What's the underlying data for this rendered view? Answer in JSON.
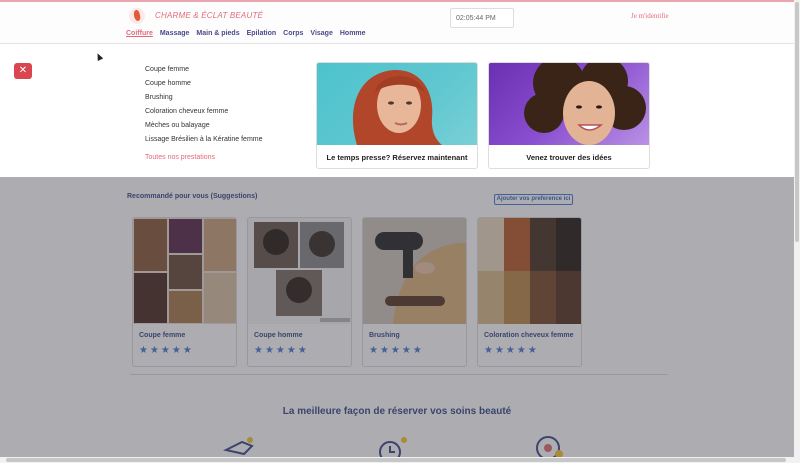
{
  "header": {
    "brand": "CHARME & ÉCLAT BEAUTÉ",
    "clock": "02:05:44 PM",
    "login": "Je m'identifie",
    "nav": [
      "Coiffure",
      "Massage",
      "Main & pieds",
      "Epilation",
      "Corps",
      "Visage",
      "Homme"
    ],
    "active_nav": "Coiffure"
  },
  "mega": {
    "close_label": "✕",
    "links": [
      "Coupe femme",
      "Coupe homme",
      "Brushing",
      "Coloration cheveux femme",
      "Mèches ou balayage",
      "Lissage Brésilien à la Kératine femme"
    ],
    "all_link": "Toutes nos prestations",
    "promos": [
      {
        "caption": "Le temps presse? Réservez maintenant"
      },
      {
        "caption": "Venez trouver des idées"
      }
    ]
  },
  "page": {
    "rec_title": "Recommandé pour vous (Suggestions)",
    "pref_button": "Ajouter vos preference ici",
    "cards": [
      {
        "title": "Coupe femme",
        "stars": "★★★★★"
      },
      {
        "title": "Coupe homme",
        "stars": "★★★★★"
      },
      {
        "title": "Brushing",
        "stars": "★★★★★"
      },
      {
        "title": "Coloration cheveux femme",
        "stars": "★★★★★"
      }
    ],
    "bottom_title": "La meilleure façon de réserver vos soins beauté"
  },
  "colors": {
    "accent": "#e46a7a",
    "nav": "#4a4a8a",
    "close": "#d9464f",
    "star": "#4a7ad0"
  }
}
